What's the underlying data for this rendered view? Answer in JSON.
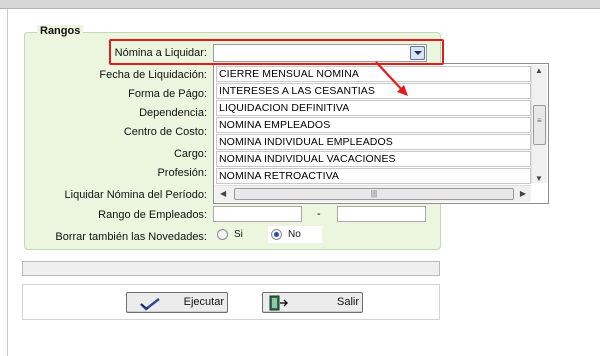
{
  "group": {
    "title": "Rangos"
  },
  "labels": {
    "nomina": "Nómina a Liquidar:",
    "fecha": "Fecha de Liquidación:",
    "forma_pago": "Forma de Págo:",
    "dependencia": "Dependencia:",
    "centro_costo": "Centro de Costo:",
    "cargo": "Cargo:",
    "profesion": "Profesión:",
    "periodo": "Liquidar Nómina del Período:",
    "rango_empleados": "Rango de Empleados:",
    "borrar_novedades": "Borrar también las Novedades:"
  },
  "nomina_combo": {
    "value": ""
  },
  "nomina_options": [
    "CIERRE MENSUAL NOMINA",
    "INTERESES A LAS CESANTIAS",
    "LIQUIDACION DEFINITIVA",
    "NOMINA EMPLEADOS",
    "NOMINA INDIVIDUAL EMPLEADOS",
    "NOMINA INDIVIDUAL VACACIONES",
    "NOMINA RETROACTIVA"
  ],
  "range": {
    "separator": "-",
    "from": "",
    "to": ""
  },
  "borrar_options": {
    "si": "Si",
    "no": "No",
    "selected": "No"
  },
  "buttons": {
    "ejecutar": "Ejecutar",
    "salir": "Salir"
  },
  "colors": {
    "highlight": "#e31b1b",
    "group_bg": "#ecf6df"
  },
  "icons": {
    "ejecutar": "check-arrow-icon",
    "salir": "exit-door-icon"
  }
}
